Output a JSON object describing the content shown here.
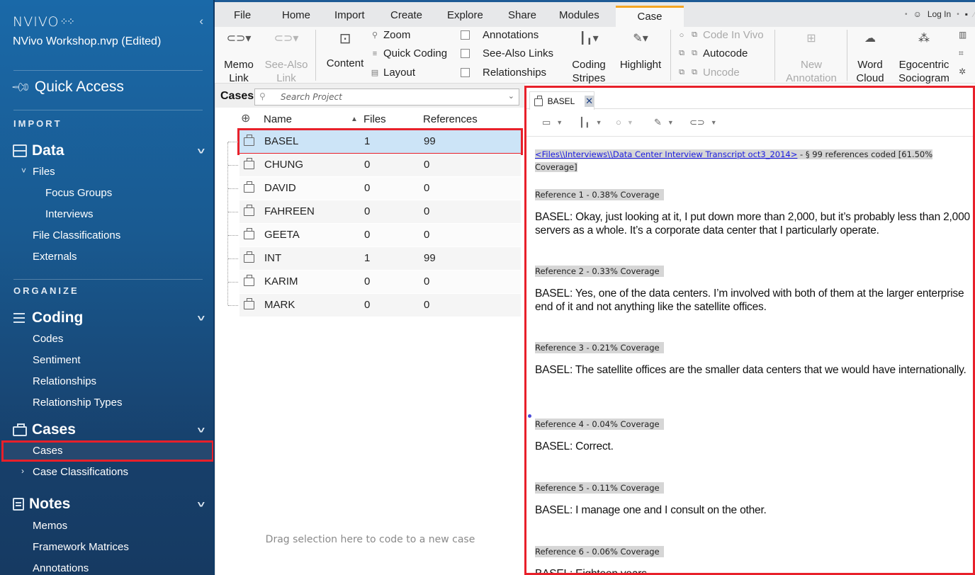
{
  "sidebar": {
    "logo": "NVIVO",
    "logo_mark": "⁘⁘",
    "collapse_icon": "‹",
    "project_name": "NVivo Workshop.nvp (Edited)",
    "quick_access": "Quick Access",
    "sections": {
      "import": "IMPORT",
      "organize": "ORGANIZE"
    },
    "groups": {
      "data": {
        "label": "Data",
        "items": [
          "Files",
          "Focus Groups",
          "Interviews",
          "File Classifications",
          "Externals"
        ]
      },
      "coding": {
        "label": "Coding",
        "items": [
          "Codes",
          "Sentiment",
          "Relationships",
          "Relationship Types"
        ]
      },
      "cases": {
        "label": "Cases",
        "items": [
          "Cases",
          "Case Classifications"
        ],
        "selected": "Cases"
      },
      "notes": {
        "label": "Notes",
        "items": [
          "Memos",
          "Framework Matrices",
          "Annotations"
        ]
      }
    }
  },
  "ribbon": {
    "tabs": [
      "File",
      "Home",
      "Import",
      "Create",
      "Explore",
      "Share",
      "Modules",
      "Case"
    ],
    "active_tab": "Case",
    "top_right": {
      "login": "Log In"
    },
    "buttons": {
      "memo_link": [
        "Memo",
        "Link"
      ],
      "see_also_link": [
        "See-Also",
        "Link"
      ],
      "content": "Content",
      "zoom": "Zoom",
      "quick_coding": "Quick Coding",
      "layout": "Layout",
      "annotations": "Annotations",
      "see_also_links": "See-Also Links",
      "relationships": "Relationships",
      "coding_stripes": [
        "Coding",
        "Stripes"
      ],
      "highlight": "Highlight",
      "code_in_vivo": "Code In Vivo",
      "autocode": "Autocode",
      "uncode": "Uncode",
      "new_annotation": [
        "New",
        "Annotation"
      ],
      "word_cloud": [
        "Word",
        "Cloud"
      ],
      "egocentric_sociogram": [
        "Egocentric",
        "Sociogram"
      ]
    }
  },
  "cases_panel": {
    "title": "Cases",
    "search_placeholder": "Search Project",
    "columns": {
      "name": "Name",
      "files": "Files",
      "references": "References"
    },
    "rows": [
      {
        "name": "BASEL",
        "files": "1",
        "references": "99",
        "selected": true
      },
      {
        "name": "CHUNG",
        "files": "0",
        "references": "0"
      },
      {
        "name": "DAVID",
        "files": "0",
        "references": "0"
      },
      {
        "name": "FAHREEN",
        "files": "0",
        "references": "0"
      },
      {
        "name": "GEETA",
        "files": "0",
        "references": "0"
      },
      {
        "name": "INT",
        "files": "1",
        "references": "99"
      },
      {
        "name": "KARIM",
        "files": "0",
        "references": "0"
      },
      {
        "name": "MARK",
        "files": "0",
        "references": "0"
      }
    ],
    "drag_hint": "Drag selection here to code to a new case"
  },
  "detail": {
    "tab_label": "BASEL",
    "close_icon": "✕",
    "file_link": "<Files\\\\Interviews\\\\Data Center Interview Transcript oct3_2014>",
    "file_summary_a": " - § 99 references coded  [61.50%",
    "file_summary_b": "Coverage]",
    "references": [
      {
        "label": "Reference 1 - 0.38% Coverage",
        "text": "BASEL:  Okay, just looking at it, I put down more than 2,000, but it’s probably less than 2,000 servers as a whole. It’s a corporate data center that I particularly operate."
      },
      {
        "label": "Reference 2 - 0.33% Coverage",
        "text": "BASEL:  Yes, one of the data centers. I’m involved with both of them at the larger enterprise end of it and not anything like the satellite offices."
      },
      {
        "label": "Reference 3 - 0.21% Coverage",
        "text": "BASEL:  The satellite offices are the smaller data centers that we would have internationally."
      },
      {
        "label": "Reference 4 - 0.04% Coverage",
        "text": "BASEL:  Correct."
      },
      {
        "label": "Reference 5 - 0.11% Coverage",
        "text": "BASEL:  I manage one and I consult on the other."
      },
      {
        "label": "Reference 6 - 0.06% Coverage",
        "text": "BASEL:  Eighteen years."
      }
    ]
  },
  "colors": {
    "sidebar_top": "#1a69a8",
    "sidebar_bottom": "#163a62",
    "active_tab_accent": "#f5a623",
    "annotation_box": "#e8202a",
    "selected_row": "#cce4f7",
    "link": "#1a1ae0"
  }
}
